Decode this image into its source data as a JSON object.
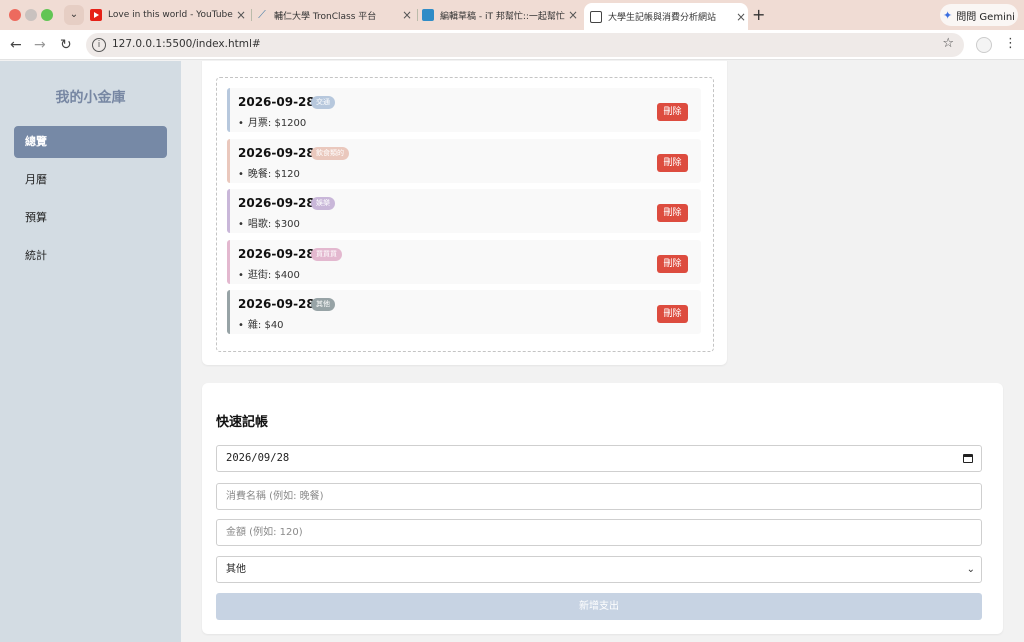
{
  "browser": {
    "tabs": [
      {
        "title": "Love in this world - YouTube",
        "icon": "youtube-icon"
      },
      {
        "title": "輔仁大學 TronClass 平台",
        "icon": "tronclass-icon"
      },
      {
        "title": "編輯草稿 - iT 邦幫忙::一起幫忙",
        "icon": "ithome-icon"
      },
      {
        "title": "大學生記帳與消費分析網站",
        "icon": "globe-icon"
      }
    ],
    "new_tab": "+",
    "gemini_label": "問問 Gemini",
    "url": "127.0.0.1:5500/index.html#"
  },
  "sidebar": {
    "brand": "我的小金庫",
    "items": [
      {
        "label": "總覽",
        "active": true
      },
      {
        "label": "月曆",
        "active": false
      },
      {
        "label": "預算",
        "active": false
      },
      {
        "label": "統計",
        "active": false
      }
    ]
  },
  "entries": [
    {
      "date": "2026-09-28",
      "tag": "交通",
      "tag_color": "#b7c8dd",
      "border_color": "#b7c8dd",
      "item": "月票: $1200",
      "delete_label": "刪除"
    },
    {
      "date": "2026-09-28",
      "tag": "飲食類的",
      "tag_color": "#eac8bd",
      "border_color": "#eac8bd",
      "item": "晚餐: $120",
      "delete_label": "刪除"
    },
    {
      "date": "2026-09-28",
      "tag": "娛樂",
      "tag_color": "#c9b7d9",
      "border_color": "#c9b7d9",
      "item": "唱歌: $300",
      "delete_label": "刪除"
    },
    {
      "date": "2026-09-28",
      "tag": "買買買",
      "tag_color": "#e3b8cf",
      "border_color": "#e3b8cf",
      "item": "逛街: $400",
      "delete_label": "刪除"
    },
    {
      "date": "2026-09-28",
      "tag": "其他",
      "tag_color": "#97a3a6",
      "border_color": "#97a3a6",
      "item": "雜: $40",
      "delete_label": "刪除"
    }
  ],
  "quick_entry": {
    "title": "快速記帳",
    "date_value": "2026/09/28",
    "name_placeholder": "消費名稱 (例如: 晚餐)",
    "amount_placeholder": "金額 (例如: 120)",
    "category_selected": "其他",
    "submit_label": "新增支出"
  },
  "colors": {
    "sidebar_bg": "#d3dce3",
    "active_nav": "#7689a6",
    "delete_button": "#dd4c3f",
    "submit_button": "#c7d3e3"
  }
}
